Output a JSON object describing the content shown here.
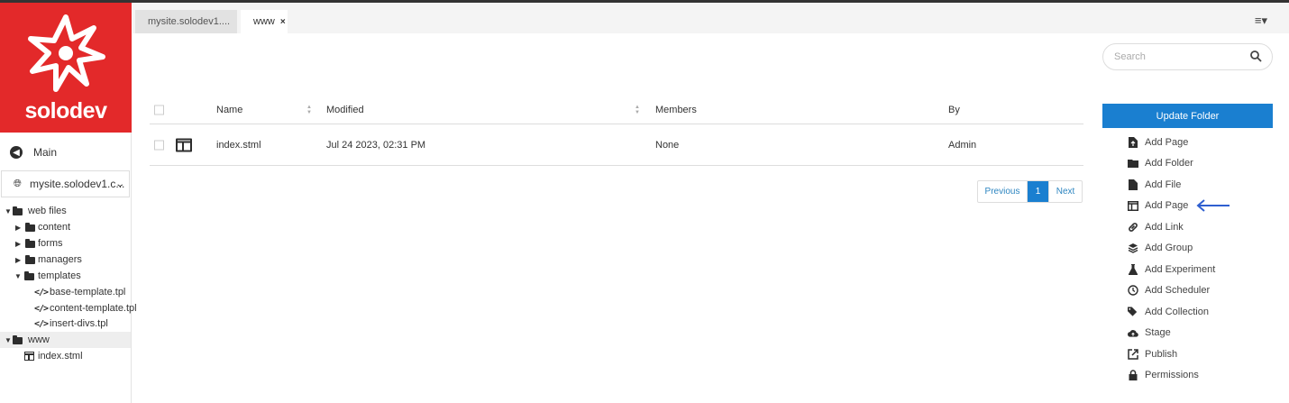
{
  "brand": {
    "name": "solodev",
    "color": "#e3292a"
  },
  "sidebar": {
    "main_label": "Main",
    "site_selector": {
      "value": "mysite.solodev1.c...",
      "icon": "globe-icon"
    },
    "tree": [
      {
        "label": "web files",
        "type": "folder",
        "expanded": true
      },
      {
        "label": "content",
        "type": "folder",
        "expanded": false
      },
      {
        "label": "forms",
        "type": "folder",
        "expanded": false
      },
      {
        "label": "managers",
        "type": "folder",
        "expanded": false
      },
      {
        "label": "templates",
        "type": "folder",
        "expanded": true
      },
      {
        "label": "base-template.tpl",
        "type": "template"
      },
      {
        "label": "content-template.tpl",
        "type": "template"
      },
      {
        "label": "insert-divs.tpl",
        "type": "template"
      },
      {
        "label": "www",
        "type": "folder",
        "expanded": true,
        "active": true
      },
      {
        "label": "index.stml",
        "type": "page"
      }
    ]
  },
  "tabs": [
    {
      "label": "mysite.solodev1....",
      "active": false
    },
    {
      "label": "www",
      "active": true,
      "close": "×"
    }
  ],
  "menu_icon": "≡▾",
  "table": {
    "columns": [
      "Name",
      "Modified",
      "Members",
      "By"
    ],
    "rows": [
      {
        "name": "index.stml",
        "modified": "Jul 24 2023, 02:31 PM",
        "members": "None",
        "by": "Admin"
      }
    ]
  },
  "pagination": {
    "previous": "Previous",
    "current": "1",
    "next": "Next"
  },
  "search": {
    "placeholder": "Search"
  },
  "panel": {
    "update_button": "Update Folder",
    "actions": [
      {
        "label": "Add Page",
        "icon": "upload-file-icon"
      },
      {
        "label": "Add Folder",
        "icon": "folder-icon"
      },
      {
        "label": "Add File",
        "icon": "file-icon"
      },
      {
        "label": "Add Page",
        "icon": "page-icon"
      },
      {
        "label": "Add Link",
        "icon": "link-icon"
      },
      {
        "label": "Add Group",
        "icon": "layers-icon"
      },
      {
        "label": "Add Experiment",
        "icon": "flask-icon"
      },
      {
        "label": "Add Scheduler",
        "icon": "clock-icon"
      },
      {
        "label": "Add Collection",
        "icon": "tags-icon"
      },
      {
        "label": "Stage",
        "icon": "cloud-upload-icon"
      },
      {
        "label": "Publish",
        "icon": "share-icon"
      },
      {
        "label": "Permissions",
        "icon": "lock-icon"
      }
    ]
  },
  "accent_color": "#1a7fd0"
}
